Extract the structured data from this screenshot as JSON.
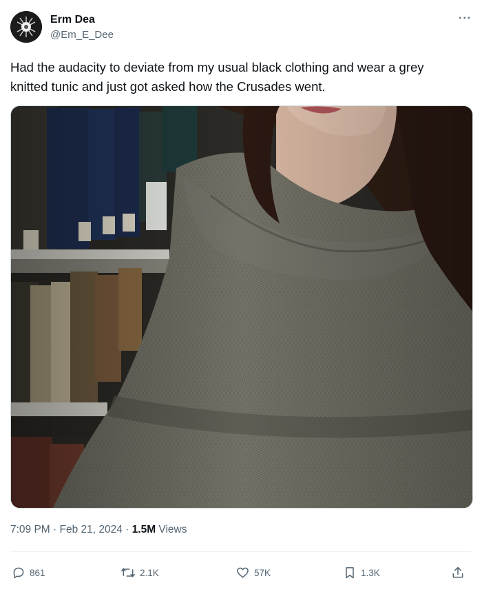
{
  "author": {
    "display_name": "Erm Dea",
    "handle": "@Em_E_Dee"
  },
  "tweet": {
    "text": "Had the audacity to deviate from my usual black clothing and wear a grey knitted tunic and just got asked how the Crusades went."
  },
  "meta": {
    "time": "7:09 PM",
    "sep1": " · ",
    "date": "Feb 21, 2024",
    "sep2": " · ",
    "views_count": "1.5M",
    "views_label": " Views"
  },
  "actions": {
    "replies": "861",
    "reposts": "2.1K",
    "likes": "57K",
    "bookmarks": "1.3K"
  },
  "icons": {
    "more": "more-horizontal-icon",
    "reply": "reply-icon",
    "repost": "repost-icon",
    "like": "heart-icon",
    "bookmark": "bookmark-icon",
    "share": "share-icon"
  },
  "colors": {
    "text_primary": "#0f1419",
    "text_secondary": "#536471",
    "tunic": "#6b6a5e",
    "bookshelf": "#2b2a26"
  }
}
